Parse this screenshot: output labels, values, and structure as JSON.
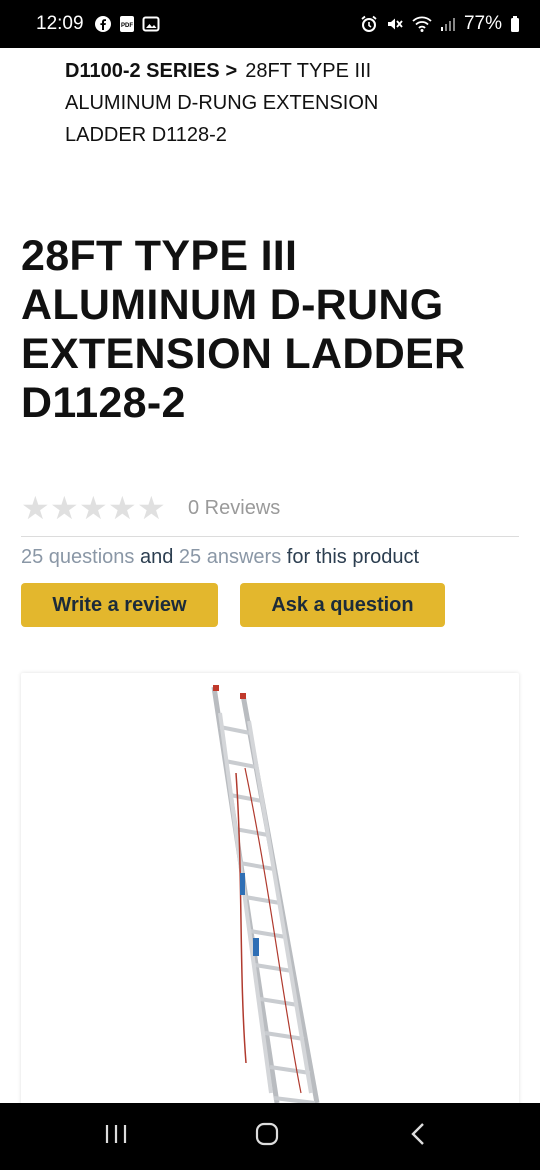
{
  "status_bar": {
    "time": "12:09",
    "battery": "77%",
    "left_icons": [
      "facebook-icon",
      "pdf-icon",
      "gallery-icon"
    ],
    "right_icons": [
      "alarm-icon",
      "mute-icon",
      "wifi-icon",
      "signal-icon",
      "battery-icon"
    ]
  },
  "breadcrumb": {
    "parent": "D1100-2 SERIES",
    "separator": ">",
    "current": "28FT TYPE III ALUMINUM D-RUNG EXTENSION LADDER D1128-2"
  },
  "product": {
    "title": "28FT TYPE III ALUMINUM D-RUNG EXTENSION LADDER D1128-2"
  },
  "reviews": {
    "rating": 0,
    "max_rating": 5,
    "count_label": "0 Reviews"
  },
  "qa": {
    "questions_link": "25 questions",
    "and_text": "and",
    "answers_link": "25 answers",
    "suffix": "for this product"
  },
  "actions": {
    "write_review": "Write a review",
    "ask_question": "Ask a question"
  },
  "colors": {
    "button_bg": "#e3b72d",
    "button_text": "#1c2b3a",
    "link_gray": "#8a97a6",
    "star_empty": "#e0e0e0"
  },
  "nav_bar": {
    "icons": [
      "recent-apps-icon",
      "home-icon",
      "back-icon"
    ]
  }
}
